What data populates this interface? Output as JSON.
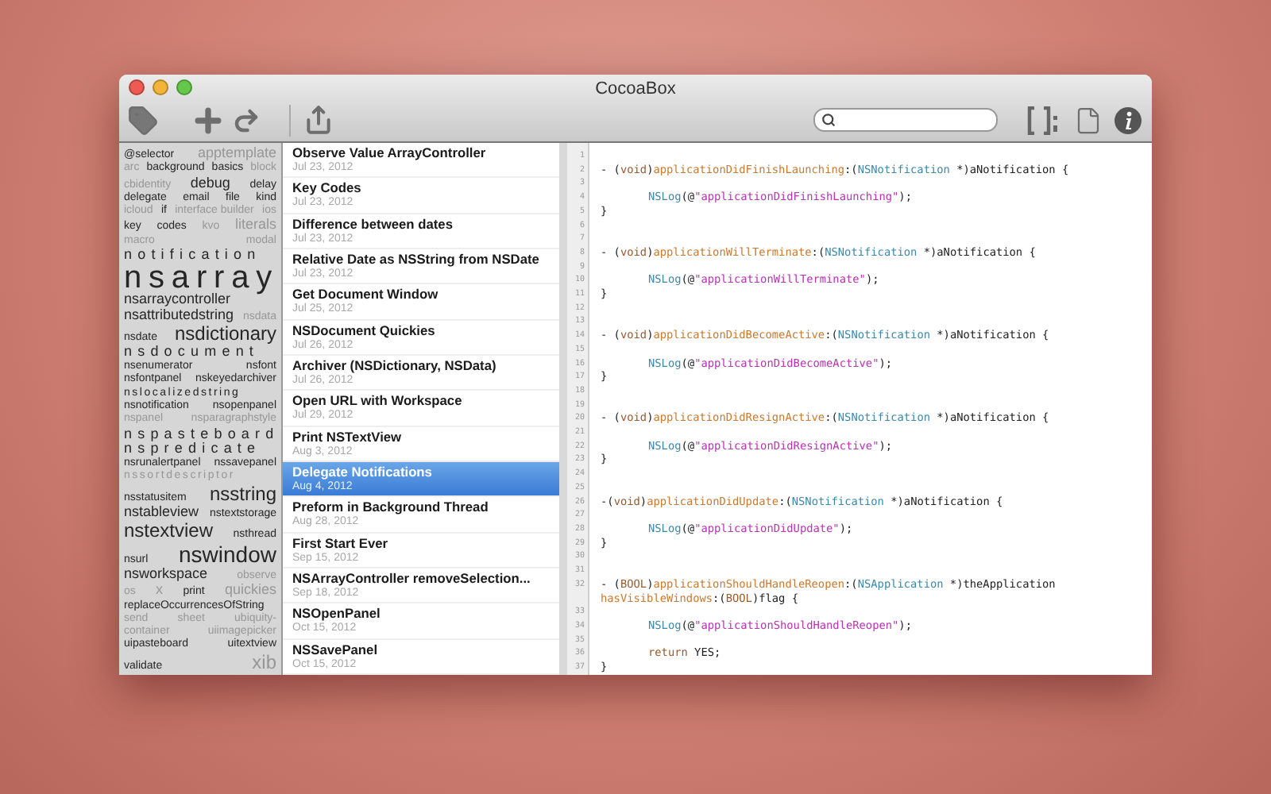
{
  "window": {
    "title": "CocoaBox"
  },
  "tag_cloud": [
    [
      {
        "text": "@selector",
        "kind": "small",
        "faded": false
      },
      {
        "text": "apptemplate",
        "kind": "medium",
        "faded": true
      }
    ],
    [
      {
        "text": "arc",
        "kind": "small",
        "faded": true
      },
      {
        "text": "background",
        "kind": "small",
        "faded": false
      },
      {
        "text": "basics",
        "kind": "small",
        "faded": false
      },
      {
        "text": "block",
        "kind": "small",
        "faded": true
      }
    ],
    [
      {
        "text": "cbidentity",
        "kind": "small",
        "faded": true
      },
      {
        "text": "debug",
        "kind": "medium",
        "faded": false
      },
      {
        "text": "delay",
        "kind": "small",
        "faded": false
      }
    ],
    [
      {
        "text": "delegate",
        "kind": "small",
        "faded": false
      },
      {
        "text": "email",
        "kind": "small",
        "faded": false
      },
      {
        "text": "file",
        "kind": "small",
        "faded": false
      },
      {
        "text": "kind",
        "kind": "small",
        "faded": false
      }
    ],
    [
      {
        "text": "icloud",
        "kind": "small",
        "faded": true
      },
      {
        "text": "if",
        "kind": "small",
        "faded": false
      },
      {
        "text": "interface builder",
        "kind": "small",
        "faded": true
      },
      {
        "text": "ios",
        "kind": "small",
        "faded": true
      }
    ],
    [
      {
        "text": "key",
        "kind": "small",
        "faded": false
      },
      {
        "text": "codes",
        "kind": "small",
        "faded": false
      },
      {
        "text": "kvo",
        "kind": "small",
        "faded": true
      },
      {
        "text": "literals",
        "kind": "medium",
        "faded": true
      }
    ],
    [
      {
        "text": "macro",
        "kind": "small",
        "faded": true
      },
      {
        "text": "modal",
        "kind": "small",
        "faded": true
      }
    ],
    [
      {
        "text": "notification",
        "kind": "medium",
        "faded": false,
        "spaced": true
      }
    ],
    [
      {
        "text": "nsarray",
        "kind": "huge",
        "faded": false,
        "spaced": true
      }
    ],
    [
      {
        "text": "nsarraycontroller",
        "kind": "medium",
        "faded": false
      }
    ],
    [
      {
        "text": "nsattributedstring",
        "kind": "medium",
        "faded": false
      },
      {
        "text": "nsdata",
        "kind": "small",
        "faded": true
      }
    ],
    [
      {
        "text": "nsdate",
        "kind": "small",
        "faded": false
      },
      {
        "text": "nsdictionary",
        "kind": "large",
        "faded": false
      }
    ],
    [
      {
        "text": "nsdocument",
        "kind": "medium",
        "faded": false,
        "spaced": true
      }
    ],
    [
      {
        "text": "nsenumerator",
        "kind": "small",
        "faded": false
      },
      {
        "text": "nsfont",
        "kind": "small",
        "faded": false
      }
    ],
    [
      {
        "text": "nsfontpanel",
        "kind": "small",
        "faded": false
      },
      {
        "text": "nskeyedarchiver",
        "kind": "small",
        "faded": false
      }
    ],
    [
      {
        "text": "nslocalizedstring",
        "kind": "small",
        "faded": false,
        "spaced": true
      }
    ],
    [
      {
        "text": "nsnotification",
        "kind": "small",
        "faded": false
      },
      {
        "text": "nsopenpanel",
        "kind": "small",
        "faded": false
      }
    ],
    [
      {
        "text": "nspanel",
        "kind": "small",
        "faded": true
      },
      {
        "text": "nsparagraphstyle",
        "kind": "small",
        "faded": true
      }
    ],
    [
      {
        "text": "nspasteboard",
        "kind": "medium",
        "faded": false,
        "spaced": true
      }
    ],
    [
      {
        "text": "nspredicate",
        "kind": "medium",
        "faded": false,
        "spaced": true
      }
    ],
    [
      {
        "text": "nsrunalertpanel",
        "kind": "small",
        "faded": false
      },
      {
        "text": "nssavepanel",
        "kind": "small",
        "faded": false
      }
    ],
    [
      {
        "text": "nssortdescriptor",
        "kind": "small",
        "faded": true,
        "spaced": true
      }
    ],
    [
      {
        "text": "nsstatusitem",
        "kind": "small",
        "faded": false
      },
      {
        "text": "nsstring",
        "kind": "large",
        "faded": false
      }
    ],
    [
      {
        "text": "nstableview",
        "kind": "medium",
        "faded": false
      },
      {
        "text": "nstextstorage",
        "kind": "small",
        "faded": false
      }
    ],
    [
      {
        "text": "nstextview",
        "kind": "large",
        "faded": false
      },
      {
        "text": "nsthread",
        "kind": "small",
        "faded": false
      }
    ],
    [
      {
        "text": "nsurl",
        "kind": "small",
        "faded": false
      },
      {
        "text": "nswindow",
        "kind": "xlarge",
        "faded": false
      }
    ],
    [
      {
        "text": "nsworkspace",
        "kind": "medium",
        "faded": false
      },
      {
        "text": "observe",
        "kind": "small",
        "faded": true
      }
    ],
    [
      {
        "text": "os",
        "kind": "small",
        "faded": true
      },
      {
        "text": "x",
        "kind": "medium",
        "faded": true
      },
      {
        "text": "print",
        "kind": "small",
        "faded": false
      },
      {
        "text": "quickies",
        "kind": "medium",
        "faded": true
      }
    ],
    [
      {
        "text": "replaceOccurrencesOfString",
        "kind": "small",
        "faded": false
      }
    ],
    [
      {
        "text": "send",
        "kind": "small",
        "faded": true
      },
      {
        "text": "sheet",
        "kind": "small",
        "faded": true
      },
      {
        "text": "ubiquity-",
        "kind": "small",
        "faded": true
      }
    ],
    [
      {
        "text": "container",
        "kind": "small",
        "faded": true
      },
      {
        "text": "uiimagepicker",
        "kind": "small",
        "faded": true
      }
    ],
    [
      {
        "text": "uipasteboard",
        "kind": "small",
        "faded": false
      },
      {
        "text": "uitextview",
        "kind": "small",
        "faded": false
      }
    ],
    [
      {
        "text": "validate",
        "kind": "small",
        "faded": false
      },
      {
        "text": "xib",
        "kind": "large",
        "faded": true
      }
    ]
  ],
  "snippets": [
    {
      "title": "Observe Value ArrayController",
      "date": "Jul 23, 2012",
      "selected": false
    },
    {
      "title": "Key Codes",
      "date": "Jul 23, 2012",
      "selected": false
    },
    {
      "title": "Difference between dates",
      "date": "Jul 23, 2012",
      "selected": false
    },
    {
      "title": "Relative Date as NSString from NSDate",
      "date": "Jul 23, 2012",
      "selected": false
    },
    {
      "title": "Get Document Window",
      "date": "Jul 25, 2012",
      "selected": false
    },
    {
      "title": "NSDocument Quickies",
      "date": "Jul 26, 2012",
      "selected": false
    },
    {
      "title": "Archiver (NSDictionary, NSData)",
      "date": "Jul 26, 2012",
      "selected": false
    },
    {
      "title": "Open URL with Workspace",
      "date": "Jul 29, 2012",
      "selected": false
    },
    {
      "title": "Print NSTextView",
      "date": "Aug 3, 2012",
      "selected": false
    },
    {
      "title": "Delegate Notifications",
      "date": "Aug 4, 2012",
      "selected": true
    },
    {
      "title": "Preform in Background Thread",
      "date": "Aug 28, 2012",
      "selected": false
    },
    {
      "title": "First Start Ever",
      "date": "Sep 15, 2012",
      "selected": false
    },
    {
      "title": "NSArrayController removeSelection...",
      "date": "Sep 18, 2012",
      "selected": false
    },
    {
      "title": "NSOpenPanel",
      "date": "Oct 15, 2012",
      "selected": false
    },
    {
      "title": "NSSavePanel",
      "date": "Oct 15, 2012",
      "selected": false
    }
  ],
  "code": [
    {
      "number": "1"
    },
    {
      "number": "2",
      "tokens": [
        {
          "kind": "plain",
          "text": "- ("
        },
        {
          "kind": "keyword",
          "text": "void"
        },
        {
          "kind": "plain",
          "text": ")"
        },
        {
          "kind": "method",
          "text": "applicationDidFinishLaunching"
        },
        {
          "kind": "plain",
          "text": ":("
        },
        {
          "kind": "type",
          "text": "NSNotification"
        },
        {
          "kind": "plain",
          "text": " *)aNotification {"
        }
      ]
    },
    {
      "number": "3"
    },
    {
      "number": "4",
      "nested": true,
      "tokens": [
        {
          "kind": "type",
          "text": "NSLog"
        },
        {
          "kind": "plain",
          "text": "(@"
        },
        {
          "kind": "string",
          "text": "\"applicationDidFinishLaunching\""
        },
        {
          "kind": "plain",
          "text": ");"
        }
      ]
    },
    {
      "number": "5",
      "tokens": [
        {
          "kind": "plain",
          "text": "}"
        }
      ]
    },
    {
      "number": "6"
    },
    {
      "number": "7"
    },
    {
      "number": "8",
      "tokens": [
        {
          "kind": "plain",
          "text": "- ("
        },
        {
          "kind": "keyword",
          "text": "void"
        },
        {
          "kind": "plain",
          "text": ")"
        },
        {
          "kind": "method",
          "text": "applicationWillTerminate"
        },
        {
          "kind": "plain",
          "text": ":("
        },
        {
          "kind": "type",
          "text": "NSNotification"
        },
        {
          "kind": "plain",
          "text": " *)aNotification {"
        }
      ]
    },
    {
      "number": "9"
    },
    {
      "number": "10",
      "nested": true,
      "tokens": [
        {
          "kind": "type",
          "text": "NSLog"
        },
        {
          "kind": "plain",
          "text": "(@"
        },
        {
          "kind": "string",
          "text": "\"applicationWillTerminate\""
        },
        {
          "kind": "plain",
          "text": ");"
        }
      ]
    },
    {
      "number": "11",
      "tokens": [
        {
          "kind": "plain",
          "text": "}"
        }
      ]
    },
    {
      "number": "12"
    },
    {
      "number": "13"
    },
    {
      "number": "14",
      "tokens": [
        {
          "kind": "plain",
          "text": "- ("
        },
        {
          "kind": "keyword",
          "text": "void"
        },
        {
          "kind": "plain",
          "text": ")"
        },
        {
          "kind": "method",
          "text": "applicationDidBecomeActive"
        },
        {
          "kind": "plain",
          "text": ":("
        },
        {
          "kind": "type",
          "text": "NSNotification"
        },
        {
          "kind": "plain",
          "text": " *)aNotification {"
        }
      ]
    },
    {
      "number": "15"
    },
    {
      "number": "16",
      "nested": true,
      "tokens": [
        {
          "kind": "type",
          "text": "NSLog"
        },
        {
          "kind": "plain",
          "text": "(@"
        },
        {
          "kind": "string",
          "text": "\"applicationDidBecomeActive\""
        },
        {
          "kind": "plain",
          "text": ");"
        }
      ]
    },
    {
      "number": "17",
      "tokens": [
        {
          "kind": "plain",
          "text": "}"
        }
      ]
    },
    {
      "number": "18"
    },
    {
      "number": "19"
    },
    {
      "number": "20",
      "tokens": [
        {
          "kind": "plain",
          "text": "- ("
        },
        {
          "kind": "keyword",
          "text": "void"
        },
        {
          "kind": "plain",
          "text": ")"
        },
        {
          "kind": "method",
          "text": "applicationDidResignActive"
        },
        {
          "kind": "plain",
          "text": ":("
        },
        {
          "kind": "type",
          "text": "NSNotification"
        },
        {
          "kind": "plain",
          "text": " *)aNotification {"
        }
      ]
    },
    {
      "number": "21"
    },
    {
      "number": "22",
      "nested": true,
      "tokens": [
        {
          "kind": "type",
          "text": "NSLog"
        },
        {
          "kind": "plain",
          "text": "(@"
        },
        {
          "kind": "string",
          "text": "\"applicationDidResignActive\""
        },
        {
          "kind": "plain",
          "text": ");"
        }
      ]
    },
    {
      "number": "23",
      "tokens": [
        {
          "kind": "plain",
          "text": "}"
        }
      ]
    },
    {
      "number": "24"
    },
    {
      "number": "25"
    },
    {
      "number": "26",
      "tokens": [
        {
          "kind": "plain",
          "text": "-("
        },
        {
          "kind": "keyword",
          "text": "void"
        },
        {
          "kind": "plain",
          "text": ")"
        },
        {
          "kind": "method",
          "text": "applicationDidUpdate"
        },
        {
          "kind": "plain",
          "text": ":("
        },
        {
          "kind": "type",
          "text": "NSNotification"
        },
        {
          "kind": "plain",
          "text": " *)aNotification {"
        }
      ]
    },
    {
      "number": "27"
    },
    {
      "number": "28",
      "nested": true,
      "tokens": [
        {
          "kind": "type",
          "text": "NSLog"
        },
        {
          "kind": "plain",
          "text": "(@"
        },
        {
          "kind": "string",
          "text": "\"applicationDidUpdate\""
        },
        {
          "kind": "plain",
          "text": ");"
        }
      ]
    },
    {
      "number": "29",
      "tokens": [
        {
          "kind": "plain",
          "text": "}"
        }
      ]
    },
    {
      "number": "30"
    },
    {
      "number": "31"
    },
    {
      "number": "32",
      "tokens": [
        {
          "kind": "plain",
          "text": "- ("
        },
        {
          "kind": "keyword",
          "text": "BOOL"
        },
        {
          "kind": "plain",
          "text": ")"
        },
        {
          "kind": "method",
          "text": "applicationShouldHandleReopen"
        },
        {
          "kind": "plain",
          "text": ":("
        },
        {
          "kind": "type",
          "text": "NSApplication"
        },
        {
          "kind": "plain",
          "text": " *)theApplication "
        },
        {
          "kind": "method",
          "text": "hasVisibleWindows"
        },
        {
          "kind": "plain",
          "text": ":("
        },
        {
          "kind": "keyword",
          "text": "BOOL"
        },
        {
          "kind": "plain",
          "text": ")flag {"
        }
      ]
    },
    {
      "number": "33"
    },
    {
      "number": "34",
      "nested": true,
      "tokens": [
        {
          "kind": "type",
          "text": "NSLog"
        },
        {
          "kind": "plain",
          "text": "(@"
        },
        {
          "kind": "string",
          "text": "\"applicationShouldHandleReopen\""
        },
        {
          "kind": "plain",
          "text": ");"
        }
      ]
    },
    {
      "number": "35"
    },
    {
      "number": "36",
      "nested": true,
      "tokens": [
        {
          "kind": "keyword",
          "text": "return"
        },
        {
          "kind": "plain",
          "text": " YES;"
        }
      ]
    },
    {
      "number": "37",
      "tokens": [
        {
          "kind": "plain",
          "text": "}"
        }
      ]
    }
  ]
}
